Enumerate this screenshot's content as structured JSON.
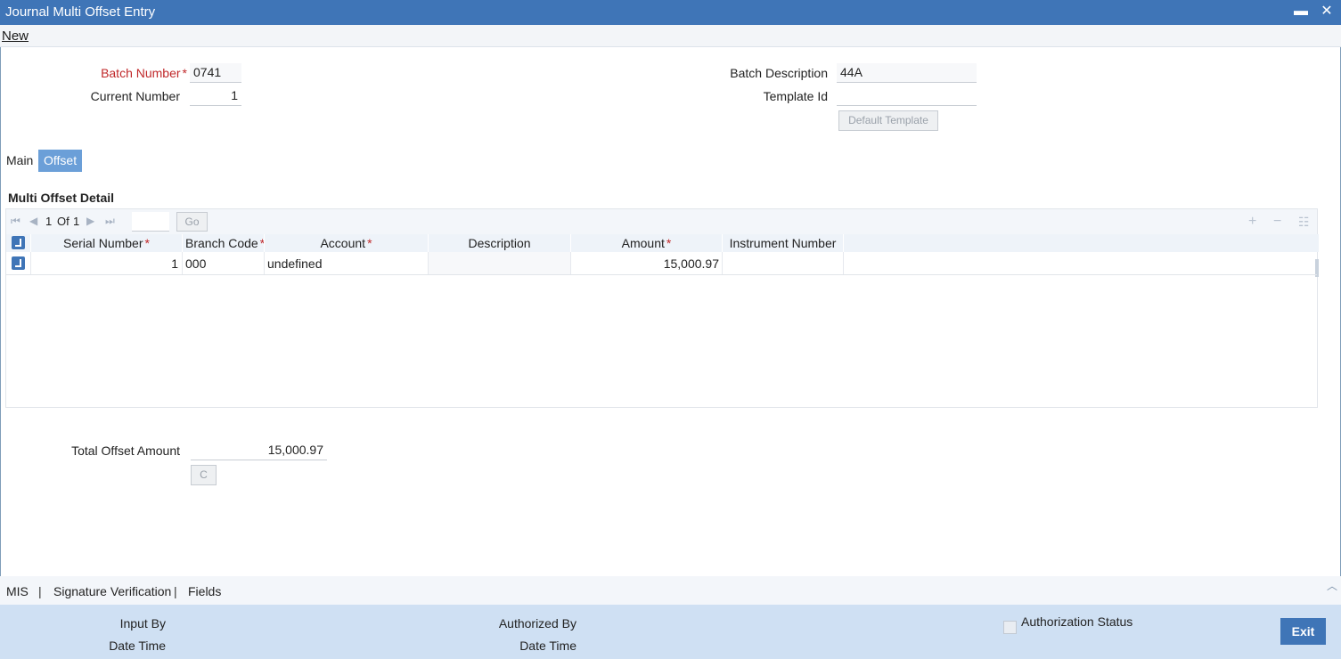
{
  "window": {
    "title": "Journal Multi Offset Entry",
    "minimize_glyph": "▬",
    "close_glyph": "✕"
  },
  "toolbar": {
    "new_label": "New"
  },
  "header": {
    "batch_number_label": "Batch Number",
    "batch_number_value": "0741",
    "current_number_label": "Current Number",
    "current_number_value": "1",
    "batch_description_label": "Batch Description",
    "batch_description_value": "44A",
    "template_id_label": "Template Id",
    "template_id_value": "",
    "default_template_label": "Default Template"
  },
  "tabs": [
    {
      "label": "Main"
    },
    {
      "label": "Offset"
    }
  ],
  "active_tab": "Offset",
  "section": {
    "title": "Multi Offset Detail"
  },
  "pager": {
    "current": "1",
    "of_label": "Of",
    "total": "1",
    "go_label": "Go"
  },
  "table": {
    "columns": [
      {
        "label": "Serial Number",
        "required": true
      },
      {
        "label": "Branch Code",
        "required": true
      },
      {
        "label": "Account",
        "required": true
      },
      {
        "label": "Description",
        "required": false
      },
      {
        "label": "Amount",
        "required": true
      },
      {
        "label": "Instrument Number",
        "required": false
      }
    ],
    "rows": [
      {
        "serial_number": "1",
        "branch_code": "000",
        "account": "undefined",
        "description": "",
        "amount": "15,000.97",
        "instrument_number": ""
      }
    ]
  },
  "totals": {
    "total_offset_amount_label": "Total Offset Amount",
    "total_offset_amount_value": "15,000.97",
    "c_button_label": "C"
  },
  "footer_tabs": {
    "mis": "MIS",
    "signature_verification": "Signature Verification",
    "fields": "Fields",
    "separator": "|"
  },
  "status": {
    "input_by_label": "Input By",
    "date_time_label": "Date Time",
    "authorized_by_label": "Authorized By",
    "date_time_label_2": "Date Time",
    "authorization_status_label": "Authorization Status",
    "exit_label": "Exit"
  },
  "icons": {
    "pager_first": "first-page-icon",
    "pager_prev": "previous-page-icon",
    "pager_next": "next-page-icon",
    "pager_last": "last-page-icon",
    "add_row": "plus-icon",
    "delete_row": "minus-icon",
    "single_view": "list-icon"
  },
  "colors": {
    "titlebar": "#3f75b7",
    "active_tab": "#6b9fd8",
    "required": "#c0282a",
    "statusbar": "#cfe0f3"
  }
}
